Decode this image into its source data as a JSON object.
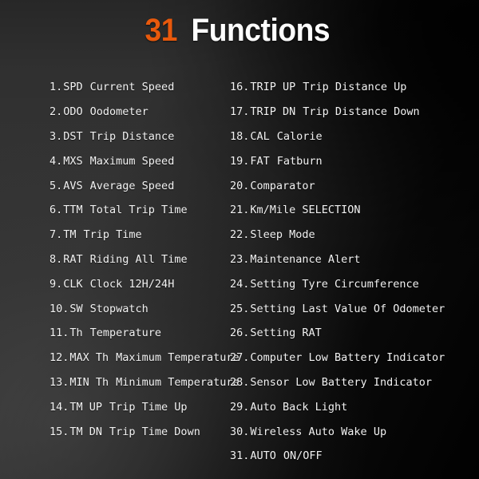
{
  "title": {
    "count": "31",
    "word": "Functions",
    "accent_color": "#e8590c",
    "text_color": "#ffffff"
  },
  "background": {
    "base_color": "#323232",
    "dark_color": "#000000",
    "light_color": "#3a3a3a"
  },
  "columns": {
    "left": [
      {
        "num": "1.",
        "code": "SPD",
        "desc": "Current Speed"
      },
      {
        "num": "2.",
        "code": "ODO",
        "desc": "Oodometer"
      },
      {
        "num": "3.",
        "code": "DST",
        "desc": "Trip Distance"
      },
      {
        "num": "4.",
        "code": "MXS",
        "desc": "Maximum Speed"
      },
      {
        "num": "5.",
        "code": "AVS",
        "desc": "Average Speed"
      },
      {
        "num": "6.",
        "code": "TTM",
        "desc": "Total Trip Time"
      },
      {
        "num": "7.",
        "code": "TM",
        "desc": "Trip Time"
      },
      {
        "num": "8.",
        "code": "RAT",
        "desc": "Riding All Time"
      },
      {
        "num": "9.",
        "code": "CLK",
        "desc": "Clock 12H/24H"
      },
      {
        "num": "10.",
        "code": "SW",
        "desc": "Stopwatch"
      },
      {
        "num": "11.",
        "code": "Th",
        "desc": "Temperature"
      },
      {
        "num": "12.",
        "code": "MAX Th",
        "desc": "Maximum Temperature"
      },
      {
        "num": "13.",
        "code": "MIN Th",
        "desc": "Minimum Temperature"
      },
      {
        "num": "14.",
        "code": "TM UP",
        "desc": "Trip Time Up"
      },
      {
        "num": "15.",
        "code": "TM DN",
        "desc": "Trip Time Down"
      }
    ],
    "right": [
      {
        "num": "16.",
        "code": "TRIP UP",
        "desc": "Trip Distance  Up"
      },
      {
        "num": "17.",
        "code": "TRIP DN",
        "desc": "Trip Distance Down"
      },
      {
        "num": "18.",
        "code": "CAL",
        "desc": "Calorie"
      },
      {
        "num": "19.",
        "code": "FAT",
        "desc": "  Fatburn"
      },
      {
        "num": "20.",
        "code": "",
        "desc": "Comparator"
      },
      {
        "num": "21.",
        "code": "",
        "desc": "Km/Mile SELECTION"
      },
      {
        "num": "22.",
        "code": "",
        "desc": "Sleep Mode"
      },
      {
        "num": "23.",
        "code": "",
        "desc": "Maintenance Alert"
      },
      {
        "num": "24.",
        "code": "",
        "desc": "Setting Tyre  Circumference"
      },
      {
        "num": "25.",
        "code": "",
        "desc": "Setting Last Value Of Odometer"
      },
      {
        "num": "26.",
        "code": "",
        "desc": "Setting RAT"
      },
      {
        "num": "27.",
        "code": "",
        "desc": "Computer  Low Battery Indicator"
      },
      {
        "num": "28.",
        "code": "",
        "desc": "Sensor Low Battery Indicator"
      },
      {
        "num": "29.",
        "code": "",
        "desc": "Auto Back Light"
      },
      {
        "num": "30.",
        "code": "",
        "desc": "Wireless Auto Wake Up"
      },
      {
        "num": "31.",
        "code": "AUTO",
        "desc": "ON/OFF"
      }
    ]
  }
}
